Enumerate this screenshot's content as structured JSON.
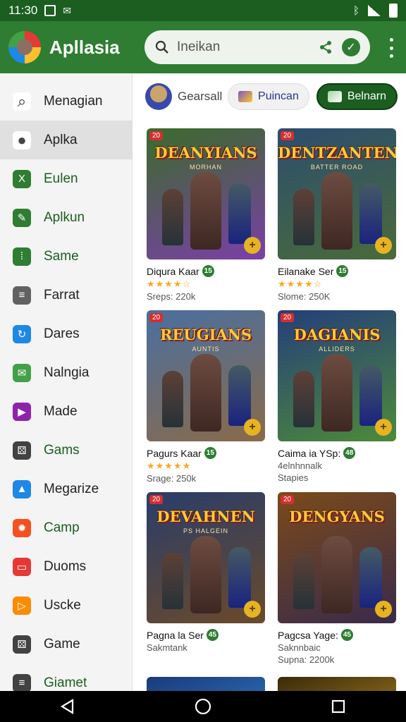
{
  "status": {
    "time": "11:30"
  },
  "app": {
    "title": "Apllasia"
  },
  "search": {
    "placeholder": "Ineikan"
  },
  "drawer": {
    "items": [
      {
        "label": "Menagian",
        "icon": "search-icon",
        "color": "#ffffff",
        "fg": "#333333"
      },
      {
        "label": "Aplka",
        "icon": "person-icon",
        "color": "#ffffff",
        "fg": "#444444"
      },
      {
        "label": "Eulen",
        "icon": "spreadsheet-icon",
        "color": "#2e7d32",
        "fg": "#ffffff"
      },
      {
        "label": "Aplkun",
        "icon": "tools-icon",
        "color": "#2e7d32",
        "fg": "#ffffff"
      },
      {
        "label": "Same",
        "icon": "grid-icon",
        "color": "#2e7d32",
        "fg": "#ffffff"
      },
      {
        "label": "Farrat",
        "icon": "list-icon",
        "color": "#616161",
        "fg": "#ffffff"
      },
      {
        "label": "Dares",
        "icon": "sync-icon",
        "color": "#1e88e5",
        "fg": "#ffffff"
      },
      {
        "label": "Nalngia",
        "icon": "message-icon",
        "color": "#43a047",
        "fg": "#ffffff"
      },
      {
        "label": "Made",
        "icon": "play-icon",
        "color": "#8e24aa",
        "fg": "#ffffff"
      },
      {
        "label": "Gams",
        "icon": "dice-icon",
        "color": "#424242",
        "fg": "#ffffff"
      },
      {
        "label": "Megarize",
        "icon": "store-icon",
        "color": "#1e88e5",
        "fg": "#ffffff"
      },
      {
        "label": "Camp",
        "icon": "gear-icon",
        "color": "#f4511e",
        "fg": "#ffffff"
      },
      {
        "label": "Duoms",
        "icon": "console-icon",
        "color": "#e53935",
        "fg": "#ffffff"
      },
      {
        "label": "Uscke",
        "icon": "play-store-icon",
        "color": "#fb8c00",
        "fg": "#ffffff"
      },
      {
        "label": "Game",
        "icon": "dice-icon",
        "color": "#424242",
        "fg": "#ffffff"
      },
      {
        "label": "Giamet",
        "icon": "list-icon",
        "color": "#424242",
        "fg": "#ffffff"
      }
    ]
  },
  "filters": {
    "chip": "Gearsall",
    "pill1": "Puincan",
    "pill2": "Belnarn"
  },
  "cards": [
    {
      "title": "DEANYIANS",
      "subtitle": "MORHAN",
      "name": "Diqura Kaar",
      "rating": "15",
      "stars": "★★★★☆",
      "meta": "Sreps: 220k",
      "bg": [
        "#3a6b2a",
        "#7b3fa8"
      ]
    },
    {
      "title": "DENTZANTENI",
      "subtitle": "BATTER ROAD",
      "name": "Eilanake Ser",
      "rating": "15",
      "stars": "★★★★☆",
      "meta": "Slome: 250K",
      "bg": [
        "#2b4d6e",
        "#4a6b3a"
      ]
    },
    {
      "title": "REUGIANS",
      "subtitle": "AUNTIS",
      "name": "Pagurs Kaar",
      "rating": "15",
      "stars": "★★★★★",
      "meta": "Srage: 250k",
      "bg": [
        "#4a6fa0",
        "#8a6a4a"
      ]
    },
    {
      "title": "DAGIANIS",
      "subtitle": "ALLIDERS",
      "name": "Caima ia YSp:",
      "rating": "48",
      "stars": "4elnhnnalk",
      "meta": "Stapies",
      "bg": [
        "#253e7a",
        "#4d8a3a"
      ]
    },
    {
      "title": "DEVAHNEN",
      "subtitle": "PS HALGEIN",
      "name": "Pagna la Ser",
      "rating": "45",
      "stars": "Sakmtank",
      "meta": "",
      "bg": [
        "#2a3d6a",
        "#6a4a2a"
      ]
    },
    {
      "title": "DENGYANS",
      "subtitle": "",
      "name": "Pagcsa Yage:",
      "rating": "45",
      "stars": "Saknnbaic",
      "meta": "Supna: 2200k",
      "bg": [
        "#7a4a1a",
        "#3a2a4a"
      ]
    }
  ]
}
